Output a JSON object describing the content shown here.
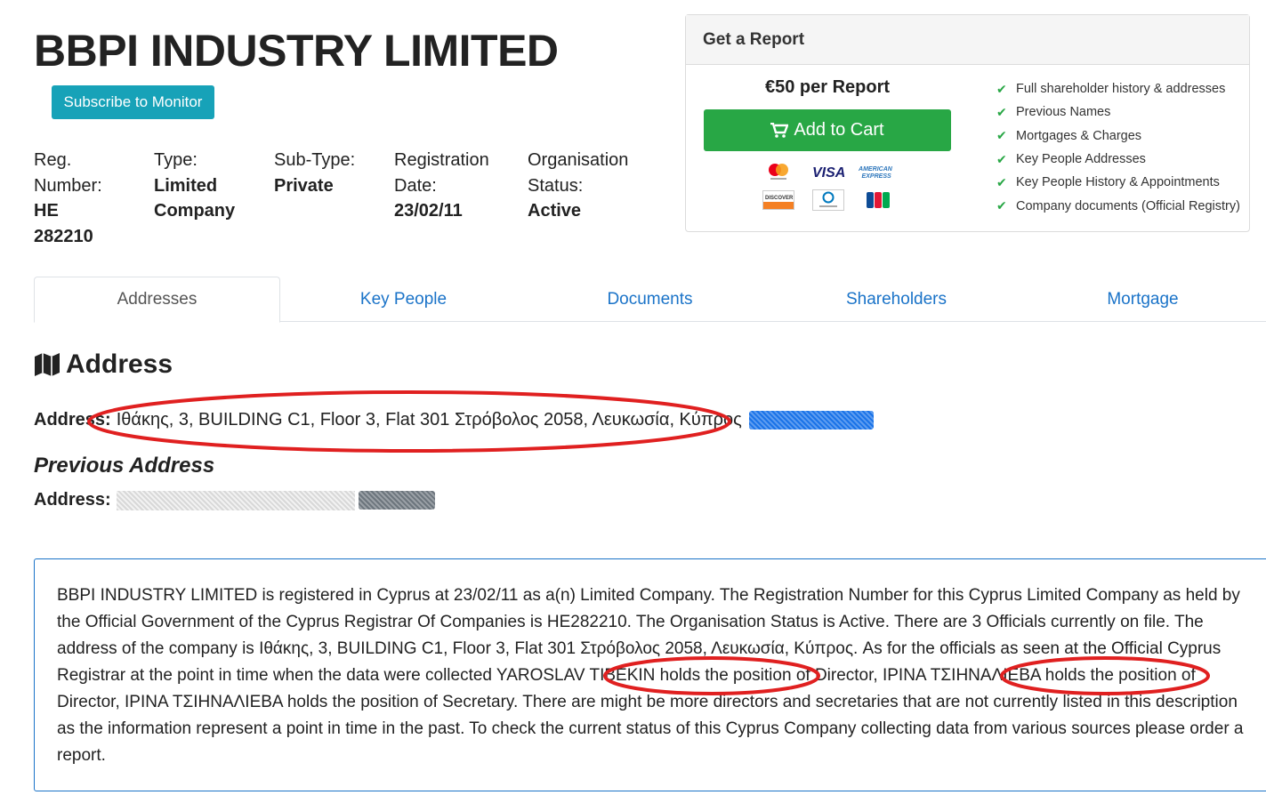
{
  "company": {
    "name": "BBPI INDUSTRY LIMITED",
    "subscribe_label": "Subscribe to Monitor"
  },
  "meta": [
    {
      "label_lines": [
        "Reg.",
        "Number:"
      ],
      "value_lines": [
        "HE",
        "282210"
      ]
    },
    {
      "label_lines": [
        "Type:"
      ],
      "value_lines": [
        "Limited",
        "Company"
      ]
    },
    {
      "label_lines": [
        "Sub-Type:"
      ],
      "value_lines": [
        "Private"
      ]
    },
    {
      "label_lines": [
        "Registration",
        "Date:"
      ],
      "value_lines": [
        "23/02/11"
      ]
    },
    {
      "label_lines": [
        "Organisation",
        "Status:"
      ],
      "value_lines": [
        "Active"
      ]
    }
  ],
  "report": {
    "heading": "Get a Report",
    "price": "€50 per Report",
    "cart_label": "Add to Cart",
    "payment_icons": [
      "mastercard-icon",
      "visa-icon",
      "american-express-icon",
      "discover-icon",
      "diners-club-icon",
      "jcb-icon"
    ],
    "features": [
      "Full shareholder history & addresses",
      "Previous Names",
      "Mortgages & Charges",
      "Key People Addresses",
      "Key People History & Appointments",
      "Company documents (Official Registry)"
    ]
  },
  "tabs": [
    {
      "label": "Addresses",
      "active": true
    },
    {
      "label": "Key People",
      "active": false
    },
    {
      "label": "Documents",
      "active": false
    },
    {
      "label": "Shareholders",
      "active": false
    },
    {
      "label": "Mortgage",
      "active": false
    }
  ],
  "address_section": {
    "title": "Address",
    "address_label": "Address:",
    "address_value": "Ιθάκης, 3, BUILDING C1, Floor 3, Flat 301 Στρόβολος 2058, Λευκωσία, Κύπρος",
    "previous_title": "Previous Address",
    "previous_label": "Address:"
  },
  "description": "BBPI INDUSTRY LIMITED is registered in Cyprus at 23/02/11 as a(n) Limited Company. The Registration Number for this Cyprus Limited Company as held by the Official Government of the Cyprus Registrar Of Companies is HE282210. The Organisation Status is Active. There are 3 Officials currently on file. The address of the company is Ιθάκης, 3, BUILDING C1, Floor 3, Flat 301 Στρόβολος 2058, Λευκωσία, Κύπρος. As for the officials as seen at the Official Cyprus Registrar at the point in time when the data were collected YAROSLAV TIBEKIN holds the position of Director, IPINA ΤΣΙΗΝΑΛΙΕΒΑ holds the position of Director, IPINA ΤΣΙΗΝΑΛΙΕΒΑ holds the position of Secretary. There are might be more directors and secretaries that are not currently listed in this description as the information represent a point in time in the past. To check the current status of this Cyprus Company collecting data from various sources please order a report.",
  "colors": {
    "accent_blue": "#1a73c8",
    "subscribe": "#17a2b8",
    "cart": "#28a745",
    "annotation_red": "#e02020"
  }
}
